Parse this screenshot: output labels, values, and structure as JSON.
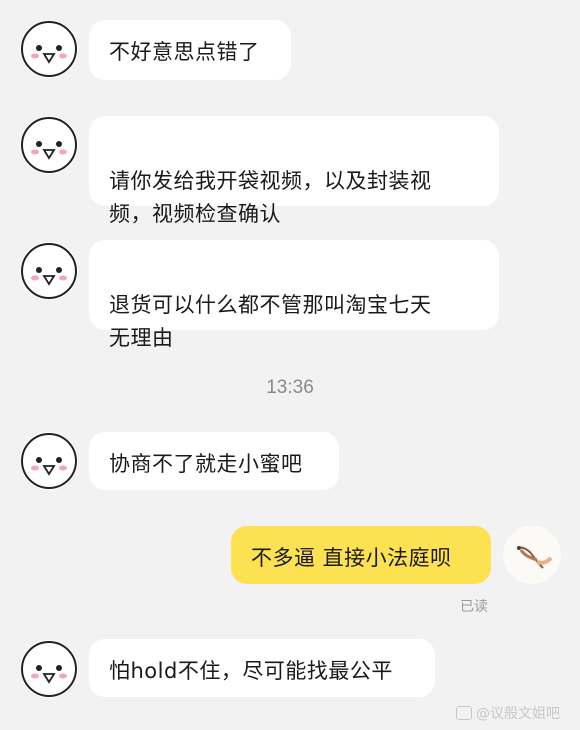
{
  "messages": [
    {
      "side": "left",
      "text": "不好意思点错了"
    },
    {
      "side": "left",
      "text": "请你发给我开袋视频，以及封装视\n频，视频检查确认"
    },
    {
      "side": "left",
      "text": "退货可以什么都不管那叫淘宝七天\n无理由"
    },
    {
      "side": "left",
      "text": "协商不了就走小蜜吧"
    },
    {
      "side": "right",
      "text": "不多逼 直接小法庭呗"
    },
    {
      "side": "left",
      "text": "怕hold不住，尽可能找最公平"
    }
  ],
  "timestamp": "13:36",
  "read_status": "已读",
  "watermark": "@议般文姐吧",
  "colors": {
    "background": "#f2f2f2",
    "bubble_other": "#ffffff",
    "bubble_self": "#fce250"
  },
  "icons": {
    "other_avatar": "cartoon-bird-avatar",
    "self_avatar": "bird-sketch-avatar"
  }
}
